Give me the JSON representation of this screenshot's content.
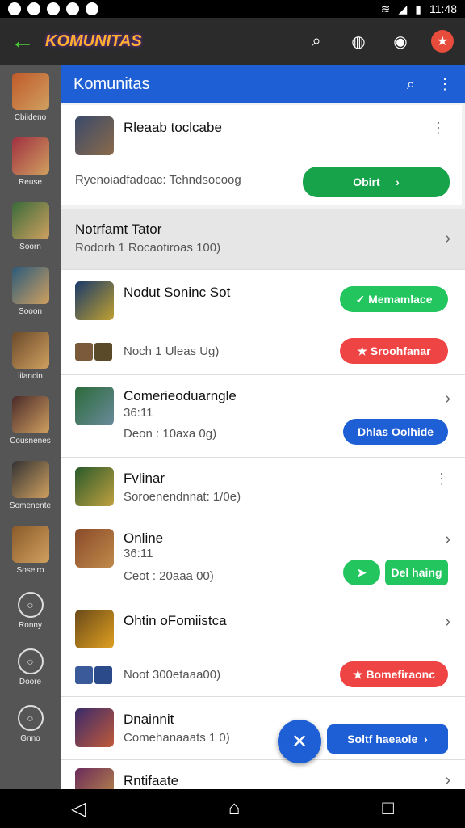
{
  "status": {
    "time": "11:48"
  },
  "header": {
    "app_name": "KOMUNITAS"
  },
  "appbar": {
    "title": "Komunitas"
  },
  "sidebar": {
    "items": [
      {
        "label": "Cbiideno",
        "color": "#c05a2a"
      },
      {
        "label": "Reuse",
        "color": "#a03040"
      },
      {
        "label": "Soorn",
        "color": "#3a6b3a"
      },
      {
        "label": "Sooon",
        "color": "#2a5a7a"
      },
      {
        "label": "lilancin",
        "color": "#6a4a2a"
      },
      {
        "label": "Cousnenes",
        "color": "#4a2a2a"
      },
      {
        "label": "Somenente",
        "color": "#333"
      },
      {
        "label": "Soseiro",
        "color": "#8a5a2a"
      }
    ],
    "bottom": [
      {
        "label": "Ronny"
      },
      {
        "label": "Doore"
      },
      {
        "label": "Gnno"
      }
    ]
  },
  "card": {
    "title": "Rleaab toclcabe",
    "subtitle": "Ryenoiadfadoac: Tehndsocoog",
    "button": "Obirt"
  },
  "section": {
    "title": "Notrfamt Tator",
    "subtitle": "Rodorh 1 Rocaotiroas 100)"
  },
  "rows": [
    {
      "title": "Nodut Soninc Sot",
      "subtitle": "Noch 1 Uleas Ug)",
      "btn1": "Memamlace",
      "btn2": "Sroohfanar"
    },
    {
      "title": "Comerieoduarngle",
      "meta": "36:11",
      "subtitle": "Deon : 10axa 0g)",
      "btn": "Dhlas Oolhide"
    },
    {
      "title": "Fvlinar",
      "subtitle": "Soroenendnnat: 1/0e)"
    },
    {
      "title": "Online",
      "meta": "36:11",
      "subtitle": "Ceot : 20aaa 00)",
      "btn": "Del haing"
    },
    {
      "title": "Ohtin oFomiistca",
      "subtitle": "Noot 300etaaa00)",
      "btn": "Bomefiraonc"
    },
    {
      "title": "Dnainnit",
      "subtitle": "Comehanaaats 1 0)",
      "btn": "Soltf haeaole"
    },
    {
      "title": "Rntifaate"
    }
  ]
}
